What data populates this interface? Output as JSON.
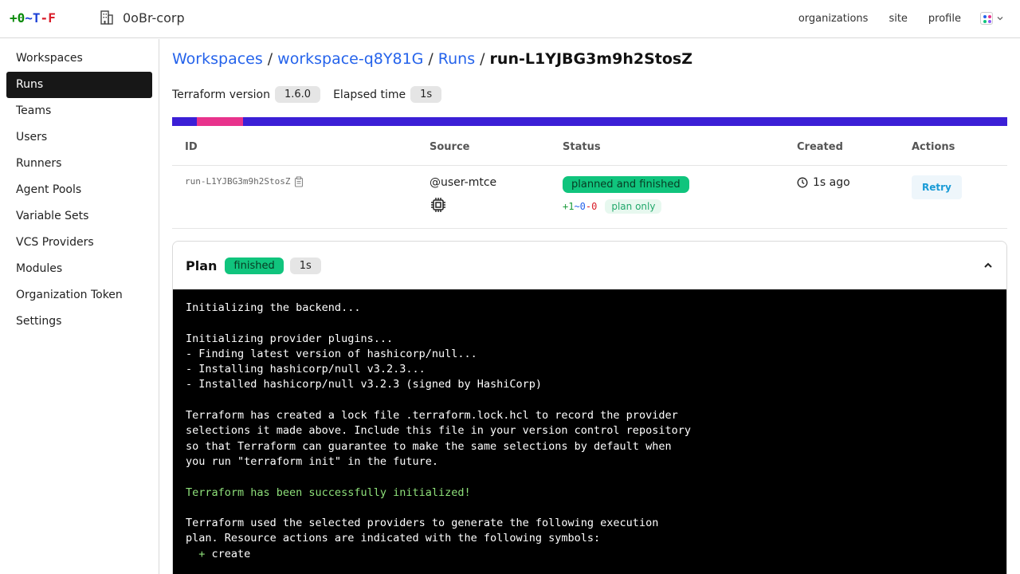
{
  "header": {
    "logo": {
      "p1": "+0",
      "p2": "~",
      "p3": "T",
      "p4": "-",
      "p5": "F"
    },
    "org_name": "0oBr-corp",
    "nav": [
      "organizations",
      "site",
      "profile"
    ]
  },
  "sidebar": {
    "items": [
      {
        "label": "Workspaces",
        "active": false
      },
      {
        "label": "Runs",
        "active": true
      },
      {
        "label": "Teams",
        "active": false
      },
      {
        "label": "Users",
        "active": false
      },
      {
        "label": "Runners",
        "active": false
      },
      {
        "label": "Agent Pools",
        "active": false
      },
      {
        "label": "Variable Sets",
        "active": false
      },
      {
        "label": "VCS Providers",
        "active": false
      },
      {
        "label": "Modules",
        "active": false
      },
      {
        "label": "Organization Token",
        "active": false
      },
      {
        "label": "Settings",
        "active": false
      }
    ]
  },
  "breadcrumb": {
    "workspaces": "Workspaces",
    "workspace": "workspace-q8Y81G",
    "runs": "Runs",
    "current": "run-L1YJBG3m9h2StosZ",
    "sep": "/"
  },
  "meta": {
    "tf_label": "Terraform version",
    "tf_version": "1.6.0",
    "elapsed_label": "Elapsed time",
    "elapsed": "1s"
  },
  "table": {
    "headers": [
      "ID",
      "Source",
      "Status",
      "Created",
      "Actions"
    ],
    "row": {
      "id": "run-L1YJBG3m9h2StosZ",
      "source": "@user-mtce",
      "status": "planned and finished",
      "plan_add": "+1",
      "plan_change": "~0",
      "plan_destroy": "-0",
      "plan_only": "plan only",
      "created": "1s ago",
      "action": "Retry"
    }
  },
  "plan": {
    "title": "Plan",
    "status": "finished",
    "duration": "1s",
    "log": [
      {
        "text": "Initializing the backend...",
        "green": false
      },
      {
        "text": "",
        "green": false
      },
      {
        "text": "Initializing provider plugins...",
        "green": false
      },
      {
        "text": "- Finding latest version of hashicorp/null...",
        "green": false
      },
      {
        "text": "- Installing hashicorp/null v3.2.3...",
        "green": false
      },
      {
        "text": "- Installed hashicorp/null v3.2.3 (signed by HashiCorp)",
        "green": false
      },
      {
        "text": "",
        "green": false
      },
      {
        "text": "Terraform has created a lock file .terraform.lock.hcl to record the provider",
        "green": false
      },
      {
        "text": "selections it made above. Include this file in your version control repository",
        "green": false
      },
      {
        "text": "so that Terraform can guarantee to make the same selections by default when",
        "green": false
      },
      {
        "text": "you run \"terraform init\" in the future.",
        "green": false
      },
      {
        "text": "",
        "green": false
      },
      {
        "text": "Terraform has been successfully initialized!",
        "green": true
      },
      {
        "text": "",
        "green": false
      },
      {
        "text": "Terraform used the selected providers to generate the following execution",
        "green": false
      },
      {
        "text": "plan. Resource actions are indicated with the following symbols:",
        "green": false
      },
      {
        "text": "  + create",
        "green": false,
        "plus": true
      }
    ]
  },
  "colors": {
    "active_nav": "#171717",
    "link": "#2563eb",
    "status_green": "#10c47d",
    "progress_bar": "#3b1fd6",
    "progress_segment": "#e8338c"
  }
}
